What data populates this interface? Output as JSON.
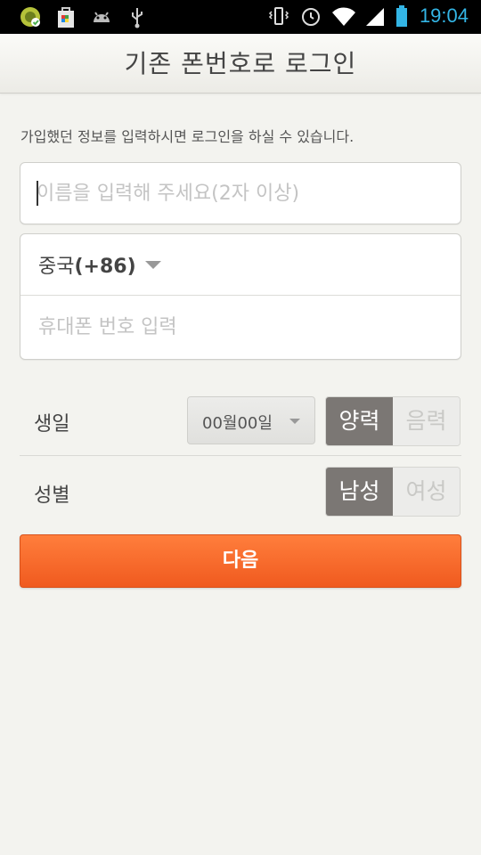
{
  "status_bar": {
    "time": "19:04",
    "left_icons": [
      "app-circle-icon",
      "shopping-bag-icon",
      "android-icon",
      "usb-icon"
    ],
    "right_icons": [
      "vibrate-icon",
      "alarm-icon",
      "wifi-icon",
      "signal-icon",
      "battery-icon"
    ]
  },
  "header": {
    "title": "기존 폰번호로 로그인"
  },
  "info_text": "가입했던 정보를 입력하시면 로그인을 하실 수 있습니다.",
  "name_field": {
    "placeholder": "이름을 입력해 주세요(2자 이상)",
    "value": ""
  },
  "country": {
    "name": "중국",
    "code": "(+86)"
  },
  "phone_field": {
    "placeholder": "휴대폰 번호 입력",
    "value": ""
  },
  "birthday": {
    "label": "생일",
    "date_value": "00월00일",
    "calendar_options": [
      "양력",
      "음력"
    ],
    "selected": "양력"
  },
  "gender": {
    "label": "성별",
    "options": [
      "남성",
      "여성"
    ],
    "selected": "남성"
  },
  "next_button": "다음",
  "colors": {
    "accent": "#f26522",
    "segment_selected": "#7b7774",
    "background": "#f3f3ef",
    "time": "#33b5e5"
  }
}
